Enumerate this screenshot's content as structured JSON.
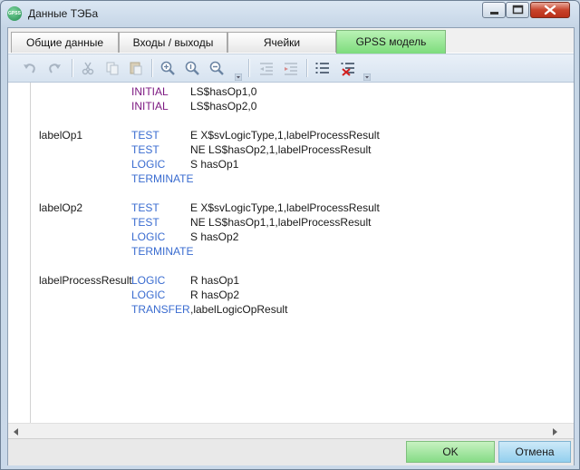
{
  "window": {
    "title": "Данные ТЭБа",
    "app_icon": "gpss-app-icon",
    "app_icon_text": "GPSS"
  },
  "tabs": [
    {
      "label": "Общие данные",
      "active": false
    },
    {
      "label": "Входы / выходы",
      "active": false
    },
    {
      "label": "Ячейки",
      "active": false
    },
    {
      "label": "GPSS модель",
      "active": true
    }
  ],
  "toolbar": {
    "icons": [
      "undo-icon",
      "redo-icon",
      "cut-icon",
      "copy-icon",
      "paste-icon",
      "zoom-reset-icon",
      "zoom-in-icon",
      "zoom-out-icon",
      "outdent-icon",
      "indent-icon",
      "list-icon",
      "remove-list-icon"
    ]
  },
  "code": {
    "lines": [
      {
        "label": "",
        "keyword": "INITIAL",
        "operand": "LS$hasOp1,0"
      },
      {
        "label": "",
        "keyword": "INITIAL",
        "operand": "LS$hasOp2,0"
      },
      {
        "label": "",
        "keyword": "",
        "operand": ""
      },
      {
        "label": "labelOp1",
        "keyword": "TEST",
        "operand": "E X$svLogicType,1,labelProcessResult"
      },
      {
        "label": "",
        "keyword": "TEST",
        "operand": "NE LS$hasOp2,1,labelProcessResult"
      },
      {
        "label": "",
        "keyword": "LOGIC",
        "operand": "S hasOp1"
      },
      {
        "label": "",
        "keyword": "TERMINATE",
        "operand": ""
      },
      {
        "label": "",
        "keyword": "",
        "operand": ""
      },
      {
        "label": "labelOp2",
        "keyword": "TEST",
        "operand": "E X$svLogicType,1,labelProcessResult"
      },
      {
        "label": "",
        "keyword": "TEST",
        "operand": "NE LS$hasOp1,1,labelProcessResult"
      },
      {
        "label": "",
        "keyword": "LOGIC",
        "operand": "S hasOp2"
      },
      {
        "label": "",
        "keyword": "TERMINATE",
        "operand": ""
      },
      {
        "label": "",
        "keyword": "",
        "operand": ""
      },
      {
        "label": "labelProcessResult",
        "keyword": "LOGIC",
        "operand": "R hasOp1"
      },
      {
        "label": "",
        "keyword": "LOGIC",
        "operand": "R hasOp2"
      },
      {
        "label": "",
        "keyword": "TRANSFER",
        "operand": ",labelLogicOpResult"
      }
    ]
  },
  "buttons": {
    "ok": "OK",
    "cancel": "Отмена"
  },
  "colors": {
    "keyword_initial": "#7d1a82",
    "keyword": "#3a6cd0",
    "ok_bg": "#86dc86",
    "cancel_bg": "#93cfee",
    "active_tab": "#7ddc7c"
  }
}
